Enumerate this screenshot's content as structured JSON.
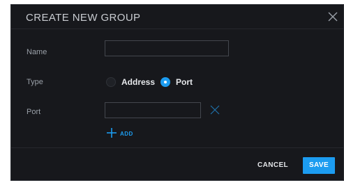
{
  "dialog": {
    "title": "CREATE NEW GROUP",
    "close_icon": "close-icon"
  },
  "form": {
    "name": {
      "label": "Name",
      "value": "",
      "placeholder": ""
    },
    "type": {
      "label": "Type",
      "options": [
        {
          "label": "Address",
          "selected": false
        },
        {
          "label": "Port",
          "selected": true
        }
      ]
    },
    "port": {
      "label": "Port",
      "value": "",
      "placeholder": "",
      "remove_icon": "close-icon"
    },
    "add": {
      "label": "ADD",
      "icon": "plus-icon"
    }
  },
  "footer": {
    "cancel_label": "CANCEL",
    "save_label": "SAVE"
  },
  "colors": {
    "dialog_bg": "#17181c",
    "accent": "#1c9cf0",
    "text": "#c9ccd1",
    "label": "#9aa0a8"
  }
}
